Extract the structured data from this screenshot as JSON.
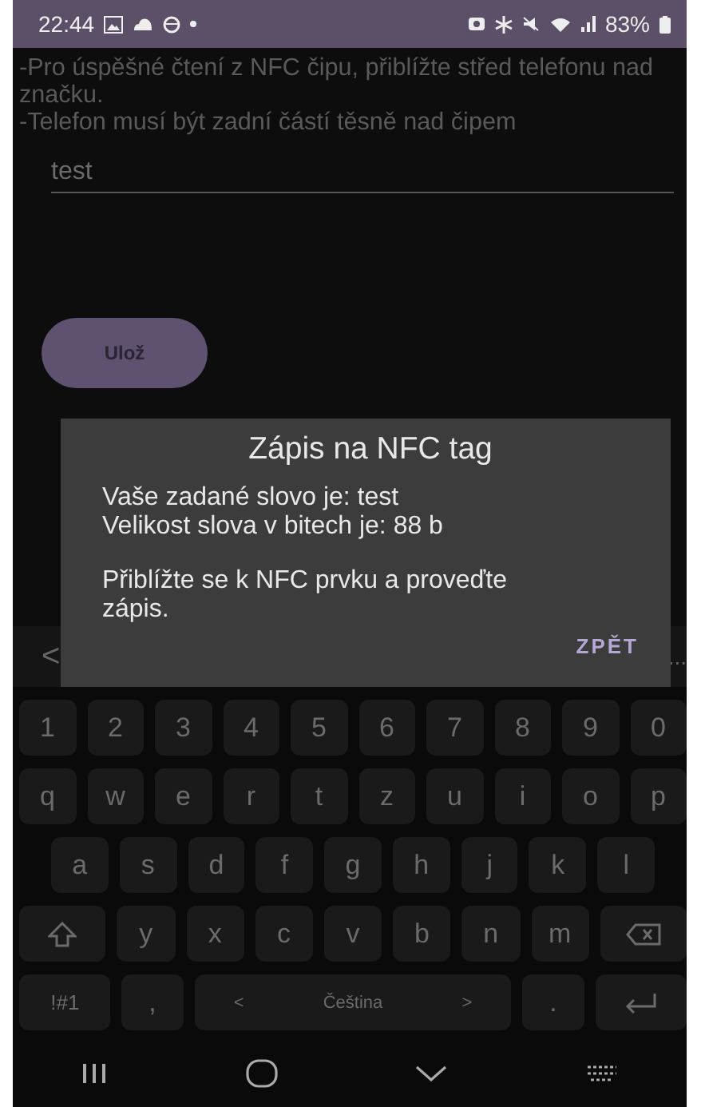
{
  "status_bar": {
    "time": "22:44",
    "battery": "83%"
  },
  "instructions": [
    "-Pro úspěšné čtení z NFC čipu, přiblížte střed telefonu nad značku.",
    "-Telefon musí být zadní částí těsně nad čipem"
  ],
  "word_field": {
    "value": "test"
  },
  "save_button": "Ulož",
  "keyboard_toolbar": {
    "back": "<",
    "more": "..."
  },
  "dialog": {
    "title": "Zápis na NFC tag",
    "lines": [
      "Vaše zadané slovo je: test",
      "Velikost slova v bitech je: 88 b"
    ],
    "message": "Přiblížte se k NFC prvku a proveďte zápis.",
    "button": "ZPĚT"
  },
  "keyboard": {
    "number_row": [
      {
        "kind": "char",
        "label": "1"
      },
      {
        "kind": "char",
        "label": "2"
      },
      {
        "kind": "char",
        "label": "3"
      },
      {
        "kind": "char",
        "label": "4"
      },
      {
        "kind": "char",
        "label": "5"
      },
      {
        "kind": "char",
        "label": "6"
      },
      {
        "kind": "char",
        "label": "7"
      },
      {
        "kind": "char",
        "label": "8"
      },
      {
        "kind": "char",
        "label": "9"
      },
      {
        "kind": "char",
        "label": "0"
      }
    ],
    "letter_rows": [
      [
        {
          "kind": "char",
          "label": "q"
        },
        {
          "kind": "char",
          "label": "w"
        },
        {
          "kind": "char",
          "label": "e"
        },
        {
          "kind": "char",
          "label": "r"
        },
        {
          "kind": "char",
          "label": "t"
        },
        {
          "kind": "char",
          "label": "z"
        },
        {
          "kind": "char",
          "label": "u"
        },
        {
          "kind": "char",
          "label": "i"
        },
        {
          "kind": "char",
          "label": "o"
        },
        {
          "kind": "char",
          "label": "p"
        }
      ],
      [
        {
          "kind": "char",
          "label": "a"
        },
        {
          "kind": "char",
          "label": "s"
        },
        {
          "kind": "char",
          "label": "d"
        },
        {
          "kind": "char",
          "label": "f"
        },
        {
          "kind": "char",
          "label": "g"
        },
        {
          "kind": "char",
          "label": "h"
        },
        {
          "kind": "char",
          "label": "j"
        },
        {
          "kind": "char",
          "label": "k"
        },
        {
          "kind": "char",
          "label": "l"
        }
      ],
      [
        {
          "kind": "shift"
        },
        {
          "kind": "char",
          "label": "y"
        },
        {
          "kind": "char",
          "label": "x"
        },
        {
          "kind": "char",
          "label": "c"
        },
        {
          "kind": "char",
          "label": "v"
        },
        {
          "kind": "char",
          "label": "b"
        },
        {
          "kind": "char",
          "label": "n"
        },
        {
          "kind": "char",
          "label": "m"
        },
        {
          "kind": "backspace"
        }
      ]
    ],
    "bottom_row": {
      "symbols_key": "!#1",
      "comma_key": ",",
      "space_key": {
        "label": "Čeština",
        "prev": "<",
        "next": ">"
      },
      "period_key": "."
    }
  }
}
